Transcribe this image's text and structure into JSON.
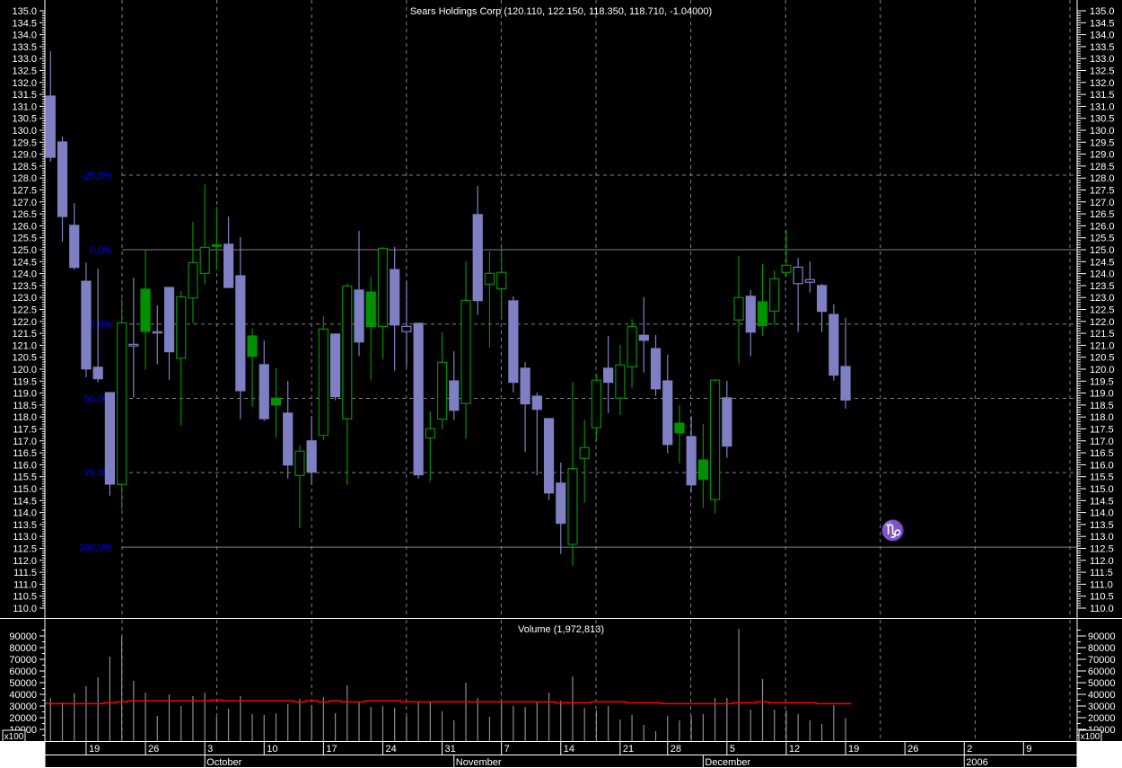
{
  "chart_data": {
    "type": "candlestick",
    "title": "Sears Holdings Corp (120.110, 122.150, 118.350, 118.710, -1.04000)",
    "price_axis": {
      "min": 110.0,
      "max": 135.0,
      "step": 0.5
    },
    "colors": {
      "up": "#009000",
      "down": "#7f7fc4",
      "grid": "#808080",
      "volume": "#8c8c8c",
      "volume_avg": "#ff0000",
      "percent_label": "#0000ff",
      "axis_text": "#ffffff"
    },
    "ohlc": [
      [
        131.43,
        133.31,
        128.68,
        128.87
      ],
      [
        129.51,
        129.74,
        125.34,
        126.39
      ],
      [
        126.02,
        126.95,
        124.17,
        124.26
      ],
      [
        123.68,
        124.47,
        119.66,
        120.01
      ],
      [
        120.08,
        124.21,
        119.45,
        119.6
      ],
      [
        119.02,
        119.02,
        114.71,
        115.19
      ],
      [
        115.18,
        122.93,
        114.15,
        121.94
      ],
      [
        120.97,
        123.83,
        118.81,
        121.04
      ],
      [
        123.35,
        124.97,
        119.97,
        121.58
      ],
      [
        121.57,
        122.67,
        120.2,
        121.57
      ],
      [
        123.42,
        123.42,
        119.56,
        120.73
      ],
      [
        120.46,
        123.27,
        117.64,
        123.03
      ],
      [
        122.98,
        126.17,
        121.92,
        124.46
      ],
      [
        124.01,
        127.74,
        123.55,
        125.1
      ],
      [
        125.2,
        126.8,
        124.2,
        125.15
      ],
      [
        125.23,
        126.39,
        123.4,
        123.42
      ],
      [
        123.91,
        125.53,
        117.91,
        119.1
      ],
      [
        121.39,
        121.69,
        118.43,
        120.54
      ],
      [
        120.19,
        121.2,
        117.83,
        117.93
      ],
      [
        118.79,
        120.04,
        117.12,
        118.51
      ],
      [
        118.16,
        119.51,
        115.42,
        115.99
      ],
      [
        115.55,
        116.8,
        113.35,
        116.57
      ],
      [
        117.0,
        118.05,
        115.15,
        115.69
      ],
      [
        117.23,
        122.22,
        117.04,
        121.68
      ],
      [
        121.47,
        121.5,
        118.7,
        118.85
      ],
      [
        117.92,
        123.6,
        115.16,
        123.48
      ],
      [
        123.31,
        125.79,
        120.54,
        121.14
      ],
      [
        123.23,
        123.87,
        119.56,
        121.78
      ],
      [
        121.79,
        125.1,
        120.42,
        125.06
      ],
      [
        124.17,
        125.11,
        119.94,
        121.85
      ],
      [
        121.57,
        123.68,
        120.11,
        121.79
      ],
      [
        121.92,
        121.92,
        115.42,
        115.58
      ],
      [
        117.12,
        118.23,
        115.31,
        117.51
      ],
      [
        117.91,
        121.54,
        117.49,
        120.29
      ],
      [
        119.51,
        120.75,
        117.87,
        118.28
      ],
      [
        118.56,
        124.51,
        117.08,
        122.88
      ],
      [
        126.47,
        127.67,
        122.27,
        122.87
      ],
      [
        123.56,
        124.92,
        120.91,
        124.01
      ],
      [
        123.37,
        125.14,
        122.04,
        124.05
      ],
      [
        122.86,
        123.05,
        119.03,
        119.45
      ],
      [
        120.04,
        120.29,
        116.53,
        118.55
      ],
      [
        118.87,
        119.02,
        115.55,
        118.32
      ],
      [
        117.93,
        117.93,
        114.52,
        114.82
      ],
      [
        115.23,
        116.09,
        112.27,
        113.55
      ],
      [
        112.67,
        119.47,
        111.77,
        115.84
      ],
      [
        116.27,
        117.88,
        114.41,
        116.72
      ],
      [
        117.55,
        119.79,
        117.03,
        119.54
      ],
      [
        120.04,
        121.39,
        118.17,
        119.45
      ],
      [
        118.79,
        121.02,
        118.09,
        120.18
      ],
      [
        120.1,
        122.09,
        119.22,
        121.79
      ],
      [
        121.42,
        123.01,
        119.86,
        121.21
      ],
      [
        120.86,
        121.43,
        118.88,
        119.18
      ],
      [
        119.51,
        120.6,
        116.48,
        116.85
      ],
      [
        117.74,
        118.5,
        116.06,
        117.34
      ],
      [
        117.18,
        118.03,
        114.84,
        115.16
      ],
      [
        116.2,
        117.71,
        114.2,
        115.39
      ],
      [
        114.54,
        119.59,
        113.96,
        119.54
      ],
      [
        118.8,
        119.51,
        116.29,
        116.78
      ],
      [
        122.06,
        124.74,
        120.24,
        123.0
      ],
      [
        123.05,
        123.31,
        120.54,
        121.55
      ],
      [
        122.82,
        124.4,
        121.4,
        121.82
      ],
      [
        122.43,
        124.14,
        121.85,
        123.79
      ],
      [
        124.05,
        125.83,
        123.86,
        124.35
      ],
      [
        123.58,
        124.66,
        121.55,
        124.27
      ],
      [
        123.64,
        124.51,
        123.21,
        123.75
      ],
      [
        123.5,
        123.57,
        121.55,
        122.42
      ],
      [
        122.29,
        122.71,
        119.52,
        119.75
      ],
      [
        120.11,
        122.15,
        118.35,
        118.71
      ]
    ],
    "percent_levels": [
      {
        "label": "-25.0%",
        "price": 128.12,
        "style": "dashed"
      },
      {
        "label": "0.0%",
        "price": 125.0,
        "style": "solid"
      },
      {
        "label": "25.0%",
        "price": 121.89,
        "style": "dashed"
      },
      {
        "label": "50.0%",
        "price": 118.78,
        "style": "dashed"
      },
      {
        "label": "75.0%",
        "price": 115.67,
        "style": "dashed"
      },
      {
        "label": "100.0%",
        "price": 112.55,
        "style": "solid"
      }
    ],
    "volume": {
      "title": "Volume (1,972,813)",
      "unit_label": "x100",
      "axis": {
        "min": 0,
        "max": 90000,
        "labels": [
          90000,
          80000,
          70000,
          60000,
          50000,
          40000,
          30000,
          20000,
          10000
        ]
      },
      "values": [
        36900,
        33100,
        40800,
        46900,
        54600,
        72300,
        90000,
        51500,
        41500,
        21500,
        40000,
        30000,
        38500,
        41500,
        20800,
        27700,
        38500,
        23100,
        22300,
        23800,
        31500,
        36200,
        30800,
        37700,
        23800,
        47700,
        33800,
        29200,
        30000,
        28500,
        21500,
        33100,
        33100,
        25400,
        17700,
        50000,
        36900,
        20800,
        34000,
        30000,
        29200,
        33100,
        41500,
        34600,
        55400,
        28500,
        26200,
        30000,
        18500,
        22300,
        13800,
        8500,
        21500,
        17700,
        21500,
        23100,
        36900,
        36900,
        96200,
        26900,
        53100,
        26900,
        26200,
        23100,
        17700,
        14600,
        30800,
        19728
      ],
      "average": [
        32000,
        32000,
        32000,
        32000,
        32000,
        32800,
        33600,
        34400,
        34400,
        34400,
        34400,
        34400,
        34400,
        34400,
        35100,
        34400,
        34400,
        34400,
        34400,
        34400,
        34400,
        33600,
        34400,
        33600,
        34400,
        33600,
        33600,
        34400,
        34400,
        34400,
        33600,
        33600,
        33600,
        33600,
        33600,
        33600,
        33600,
        33600,
        33600,
        33600,
        33600,
        33600,
        33600,
        32800,
        32800,
        32800,
        33600,
        33600,
        33600,
        32800,
        32800,
        32800,
        32000,
        32000,
        32000,
        32000,
        32000,
        32000,
        32800,
        32800,
        33600,
        32800,
        32800,
        32800,
        32800,
        32000,
        32000,
        32000
      ]
    },
    "x_axis": {
      "day_labels": [
        {
          "label": "19",
          "bar": 3
        },
        {
          "label": "26",
          "bar": 8
        },
        {
          "label": "3",
          "bar": 13
        },
        {
          "label": "10",
          "bar": 18
        },
        {
          "label": "17",
          "bar": 23
        },
        {
          "label": "24",
          "bar": 28
        },
        {
          "label": "31",
          "bar": 33
        },
        {
          "label": "7",
          "bar": 38
        },
        {
          "label": "14",
          "bar": 43
        },
        {
          "label": "21",
          "bar": 48
        },
        {
          "label": "28",
          "bar": 52
        },
        {
          "label": "5",
          "bar": 57
        },
        {
          "label": "12",
          "bar": 62
        },
        {
          "label": "19",
          "bar": 67
        },
        {
          "label": "26",
          "bar": 72
        },
        {
          "label": "2",
          "bar": 77
        },
        {
          "label": "9",
          "bar": 82
        }
      ],
      "month_labels": [
        {
          "label": "October",
          "bar": 13
        },
        {
          "label": "November",
          "bar": 34
        },
        {
          "label": "December",
          "bar": 55
        },
        {
          "label": "2006",
          "bar": 77
        }
      ]
    },
    "annotation_symbol": "♑",
    "grid": true
  }
}
